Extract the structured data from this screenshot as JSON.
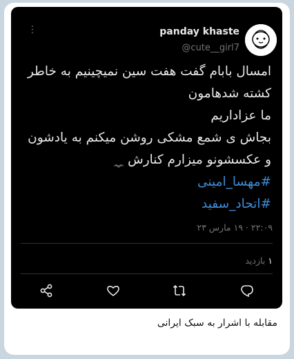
{
  "post": {
    "author_name": "panday khaste",
    "author_handle": "@cute__girl7",
    "more_icon": "more-vertical-icon",
    "lines": [
      "امسال بابام گفت هفت سین نمیچینیم به خاطر",
      "کشته شدهامون",
      "ما عزاداریم",
      "بجاش ی شمع مشکی روشن میکنم به یادشون",
      "و عکسشونو میزارم کنارش"
    ],
    "emoji": "black-heart-emoji",
    "hashtags": [
      "#مهسا_امینی",
      "#اتحاد_سفید"
    ],
    "timestamp": "۲۲:۰۹ · ۱۹ مارس ۲۳",
    "views_count": "۱",
    "views_label": "بازدید",
    "actions": [
      "share-icon",
      "like-icon",
      "retweet-icon",
      "reply-icon"
    ]
  },
  "caption": "مقابله با اشرار به سبک ایرانی",
  "colors": {
    "background": "#c9d5df",
    "tweet_bg": "#000000",
    "hashtag": "#3f8cd7",
    "muted": "#71767b"
  }
}
